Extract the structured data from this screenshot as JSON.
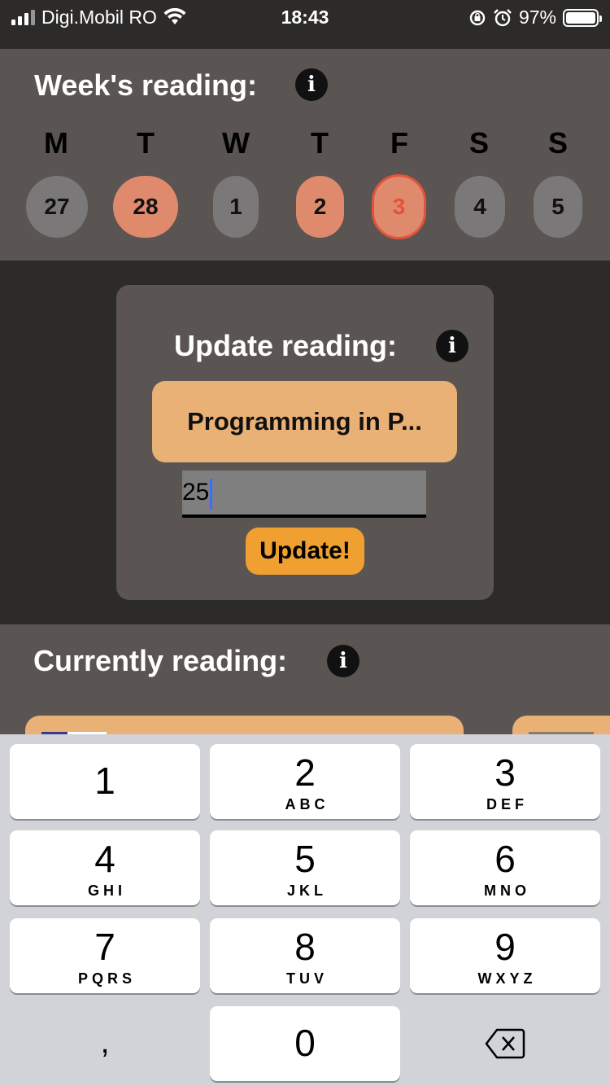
{
  "status_bar": {
    "carrier": "Digi.Mobil RO",
    "time": "18:43",
    "battery": "97%"
  },
  "week": {
    "title": "Week's reading:",
    "days": [
      {
        "letter": "M",
        "date": "27",
        "state": "none"
      },
      {
        "letter": "T",
        "date": "28",
        "state": "read"
      },
      {
        "letter": "W",
        "date": "1",
        "state": "none"
      },
      {
        "letter": "T",
        "date": "2",
        "state": "read"
      },
      {
        "letter": "F",
        "date": "3",
        "state": "today"
      },
      {
        "letter": "S",
        "date": "4",
        "state": "none"
      },
      {
        "letter": "S",
        "date": "5",
        "state": "none"
      }
    ]
  },
  "update": {
    "title": "Update reading:",
    "book": "Programming in P...",
    "pages_value": "25",
    "button": "Update!"
  },
  "current": {
    "title": "Currently reading:"
  },
  "keyboard": {
    "keys": [
      {
        "num": "1",
        "letters": ""
      },
      {
        "num": "2",
        "letters": "ABC"
      },
      {
        "num": "3",
        "letters": "DEF"
      },
      {
        "num": "4",
        "letters": "GHI"
      },
      {
        "num": "5",
        "letters": "JKL"
      },
      {
        "num": "6",
        "letters": "MNO"
      },
      {
        "num": "7",
        "letters": "PQRS"
      },
      {
        "num": "8",
        "letters": "TUV"
      },
      {
        "num": "9",
        "letters": "WXYZ"
      }
    ],
    "comma": ",",
    "zero": "0"
  },
  "colors": {
    "accent_orange": "#eab176",
    "read_day": "#e08a6d",
    "today_border": "#e2543a",
    "button": "#f0a030",
    "panel": "#5a5552"
  },
  "icons": [
    "signal-icon",
    "wifi-icon",
    "rotation-lock-icon",
    "alarm-icon",
    "battery-icon",
    "info-icon",
    "backspace-icon"
  ]
}
